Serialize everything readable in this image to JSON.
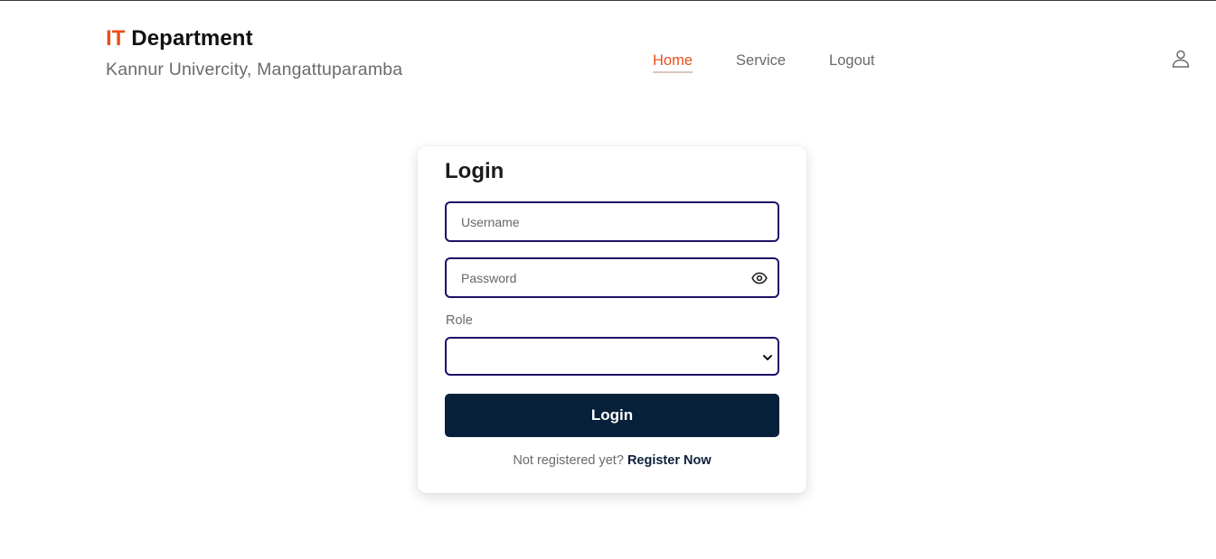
{
  "header": {
    "brand_accent": "IT",
    "brand_rest": " Department",
    "subtitle": "Kannur Univercity, Mangattuparamba"
  },
  "nav": {
    "home": "Home",
    "service": "Service",
    "logout": "Logout",
    "active": "Home"
  },
  "icons": {
    "user": "user-icon",
    "password_toggle": "eye-icon",
    "select_arrow": "chevron-down-icon"
  },
  "login_form": {
    "title": "Login",
    "username": {
      "placeholder": "Username",
      "value": ""
    },
    "password": {
      "placeholder": "Password",
      "value": ""
    },
    "role": {
      "label": "Role",
      "selected": ""
    },
    "submit_label": "Login",
    "register_prompt": "Not registered yet?",
    "register_link": "Register Now"
  },
  "colors": {
    "accent": "#e8501a",
    "input_border": "#1c1169",
    "button_bg": "#07213a"
  }
}
